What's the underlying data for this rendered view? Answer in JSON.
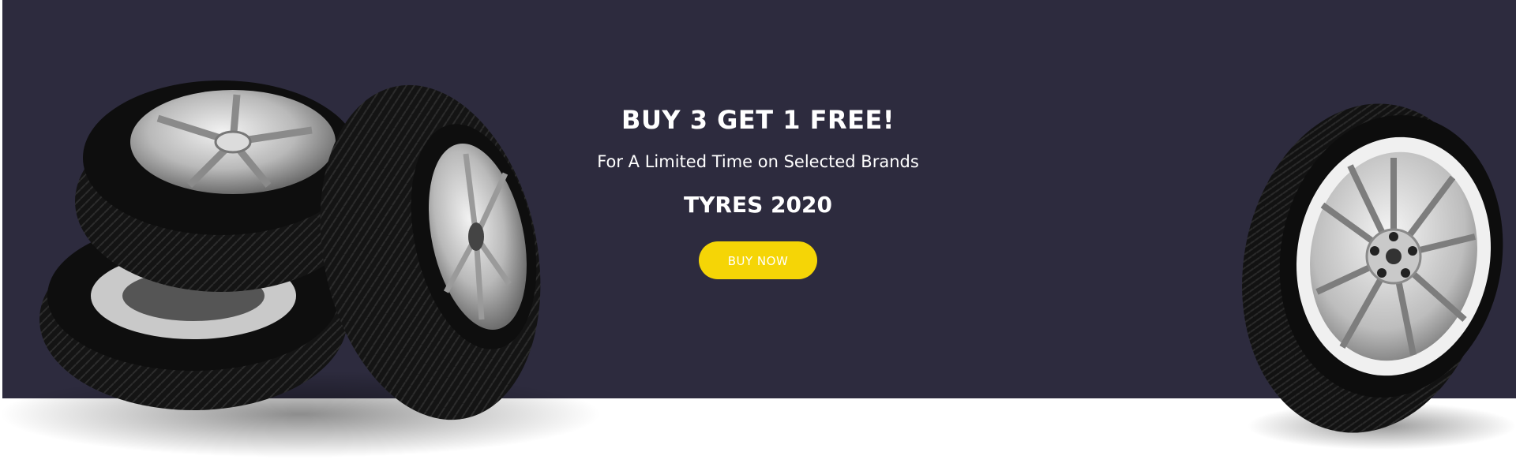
{
  "promo": {
    "headline": "BUY 3 GET 1 FREE!",
    "subline": "For A Limited Time on Selected Brands",
    "product": "TYRES 2020",
    "cta_label": "BUY NOW"
  },
  "colors": {
    "background_dark": "#2d2b3e",
    "cta_yellow": "#f5d506",
    "text": "#ffffff"
  },
  "images": {
    "left": "stacked-tyres-image",
    "right": "single-tyre-image"
  }
}
